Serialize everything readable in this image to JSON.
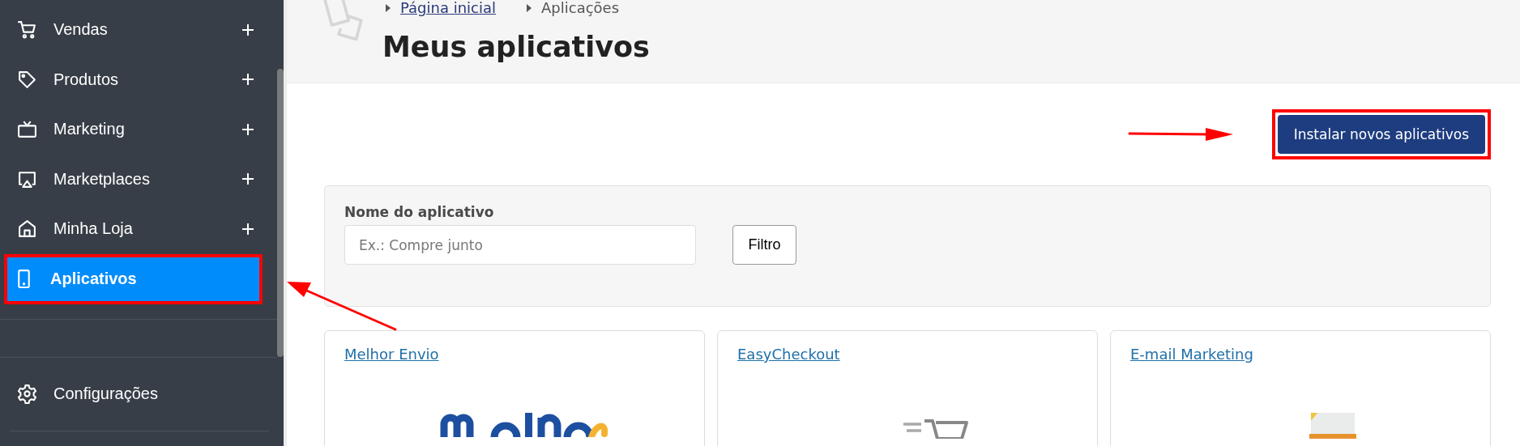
{
  "sidebar": {
    "items": [
      {
        "label": "Vendas",
        "expandable": true,
        "selected": false,
        "highlighted": false
      },
      {
        "label": "Produtos",
        "expandable": true,
        "selected": false,
        "highlighted": false
      },
      {
        "label": "Marketing",
        "expandable": true,
        "selected": false,
        "highlighted": false
      },
      {
        "label": "Marketplaces",
        "expandable": true,
        "selected": false,
        "highlighted": false
      },
      {
        "label": "Minha Loja",
        "expandable": true,
        "selected": false,
        "highlighted": false
      },
      {
        "label": "Aplicativos",
        "expandable": false,
        "selected": true,
        "highlighted": true
      }
    ],
    "footer_items": [
      {
        "label": "Configurações"
      }
    ]
  },
  "breadcrumb": [
    {
      "label": "Página inicial",
      "kind": "link"
    },
    {
      "label": "Aplicações",
      "kind": "current"
    }
  ],
  "page_title": "Meus aplicativos",
  "install_button": {
    "label": "Instalar novos aplicativos",
    "highlighted": true
  },
  "filter": {
    "label": "Nome do aplicativo",
    "placeholder": "Ex.: Compre junto",
    "button": "Filtro"
  },
  "apps": [
    {
      "name": "Melhor Envio"
    },
    {
      "name": "EasyCheckout"
    },
    {
      "name": "E-mail Marketing"
    }
  ]
}
